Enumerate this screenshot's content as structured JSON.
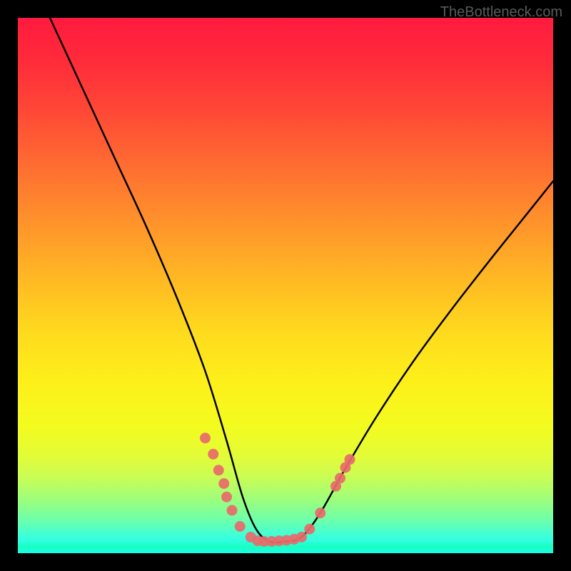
{
  "attribution": "TheBottleneck.com",
  "colors": {
    "frame": "#000000",
    "curve": "#000000",
    "marker": "#e86a6a",
    "marker_edge": "#d85858",
    "attr_text": "#5a5a5a"
  },
  "chart_data": {
    "type": "line",
    "title": "",
    "xlabel": "",
    "ylabel": "",
    "x": [
      0.0,
      0.03,
      0.06,
      0.09,
      0.12,
      0.15,
      0.18,
      0.21,
      0.24,
      0.27,
      0.3,
      0.33,
      0.36,
      0.39,
      0.42,
      0.45,
      0.48,
      0.5,
      0.53,
      0.56,
      0.59,
      0.62,
      0.65,
      0.68,
      0.71,
      0.74,
      0.77,
      0.8,
      0.83,
      0.86,
      0.89,
      0.92,
      0.95,
      0.98,
      1.0
    ],
    "values": [
      1.0,
      0.96,
      0.9,
      0.83,
      0.76,
      0.69,
      0.62,
      0.56,
      0.49,
      0.42,
      0.36,
      0.29,
      0.23,
      0.17,
      0.12,
      0.07,
      0.03,
      0.01,
      0.01,
      0.02,
      0.05,
      0.09,
      0.13,
      0.18,
      0.23,
      0.28,
      0.33,
      0.38,
      0.43,
      0.48,
      0.53,
      0.57,
      0.62,
      0.66,
      0.7
    ],
    "xlim": [
      0,
      1
    ],
    "ylim": [
      0,
      1
    ],
    "markers": [
      {
        "x": 0.35,
        "y": 0.215
      },
      {
        "x": 0.365,
        "y": 0.185
      },
      {
        "x": 0.375,
        "y": 0.155
      },
      {
        "x": 0.385,
        "y": 0.13
      },
      {
        "x": 0.39,
        "y": 0.105
      },
      {
        "x": 0.4,
        "y": 0.08
      },
      {
        "x": 0.415,
        "y": 0.05
      },
      {
        "x": 0.435,
        "y": 0.03
      },
      {
        "x": 0.448,
        "y": 0.023
      },
      {
        "x": 0.46,
        "y": 0.022
      },
      {
        "x": 0.474,
        "y": 0.022
      },
      {
        "x": 0.488,
        "y": 0.023
      },
      {
        "x": 0.502,
        "y": 0.024
      },
      {
        "x": 0.516,
        "y": 0.026
      },
      {
        "x": 0.53,
        "y": 0.03
      },
      {
        "x": 0.545,
        "y": 0.045
      },
      {
        "x": 0.565,
        "y": 0.075
      },
      {
        "x": 0.594,
        "y": 0.125
      },
      {
        "x": 0.602,
        "y": 0.14
      },
      {
        "x": 0.612,
        "y": 0.16
      },
      {
        "x": 0.62,
        "y": 0.175
      }
    ],
    "series": [
      {
        "name": "curve-left",
        "path": [
          {
            "x": 0.06,
            "y": 1.0
          },
          {
            "x": 0.12,
            "y": 0.87
          },
          {
            "x": 0.18,
            "y": 0.74
          },
          {
            "x": 0.24,
            "y": 0.61
          },
          {
            "x": 0.3,
            "y": 0.47
          },
          {
            "x": 0.35,
            "y": 0.34
          },
          {
            "x": 0.39,
            "y": 0.21
          },
          {
            "x": 0.42,
            "y": 0.105
          },
          {
            "x": 0.445,
            "y": 0.045
          },
          {
            "x": 0.47,
            "y": 0.022
          },
          {
            "x": 0.5,
            "y": 0.022
          }
        ]
      },
      {
        "name": "curve-right",
        "path": [
          {
            "x": 0.5,
            "y": 0.022
          },
          {
            "x": 0.53,
            "y": 0.03
          },
          {
            "x": 0.565,
            "y": 0.075
          },
          {
            "x": 0.61,
            "y": 0.155
          },
          {
            "x": 0.67,
            "y": 0.255
          },
          {
            "x": 0.74,
            "y": 0.36
          },
          {
            "x": 0.81,
            "y": 0.455
          },
          {
            "x": 0.88,
            "y": 0.545
          },
          {
            "x": 0.94,
            "y": 0.62
          },
          {
            "x": 1.0,
            "y": 0.695
          }
        ]
      }
    ]
  }
}
